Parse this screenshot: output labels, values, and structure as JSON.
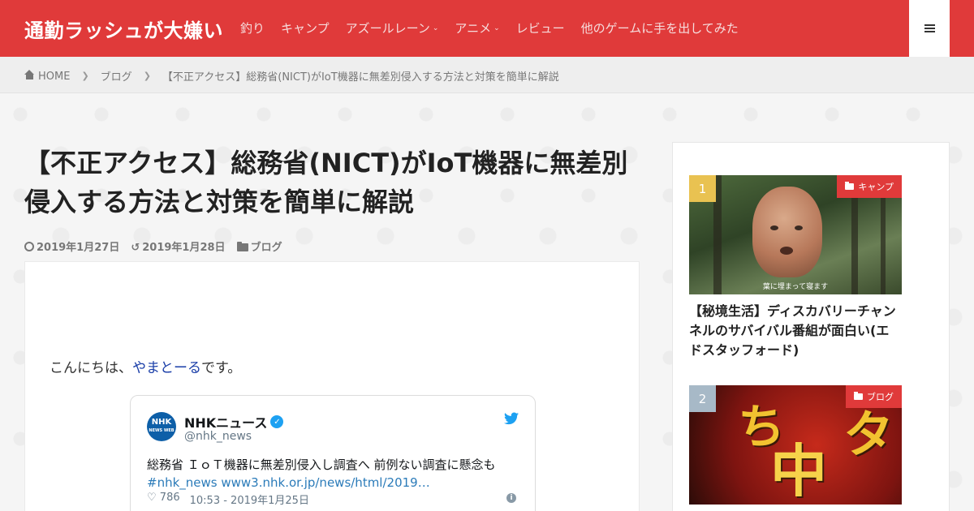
{
  "header": {
    "site_title": "通勤ラッシュが大嫌い",
    "nav": [
      {
        "label": "釣り",
        "has_dropdown": false
      },
      {
        "label": "キャンプ",
        "has_dropdown": false
      },
      {
        "label": "アズールレーン",
        "has_dropdown": true
      },
      {
        "label": "アニメ",
        "has_dropdown": true
      },
      {
        "label": "レビュー",
        "has_dropdown": false
      },
      {
        "label": "他のゲームに手を出してみた",
        "has_dropdown": false
      }
    ],
    "accent_color": "#e03a3a"
  },
  "breadcrumb": {
    "home": "HOME",
    "category": "ブログ",
    "current": "【不正アクセス】総務省(NICT)がIoT機器に無差別侵入する方法と対策を簡単に解説"
  },
  "article": {
    "title": "【不正アクセス】総務省(NICT)がIoT機器に無差別侵入する方法と対策を簡単に解説",
    "published": "2019年1月27日",
    "updated": "2019年1月28日",
    "category": "ブログ",
    "greeting_prefix": "こんにちは、",
    "greeting_link": "やまとーる",
    "greeting_suffix": "です。"
  },
  "tweet": {
    "logo_text": "NHK",
    "logo_sub": "NEWS WEB",
    "name": "NHKニュース",
    "handle": "@nhk_news",
    "text": "総務省 ＩｏＴ機器に無差別侵入し調査へ 前例ない調査に懸念も",
    "hashtag": "#nhk_news",
    "link": "www3.nhk.or.jp/news/html/2019…",
    "likes": "786",
    "timestamp": "10:53 - 2019年1月25日",
    "link_color": "#2b7bb9"
  },
  "sidebar": {
    "cards": [
      {
        "rank": "1",
        "category": "キャンプ",
        "thumb_caption": "葉に埋まって寝ます",
        "title": "【秘境生活】ディスカバリーチャンネルのサバイバル番組が面白い(エドスタッフォード)"
      },
      {
        "rank": "2",
        "category": "ブログ",
        "title": ""
      }
    ]
  }
}
